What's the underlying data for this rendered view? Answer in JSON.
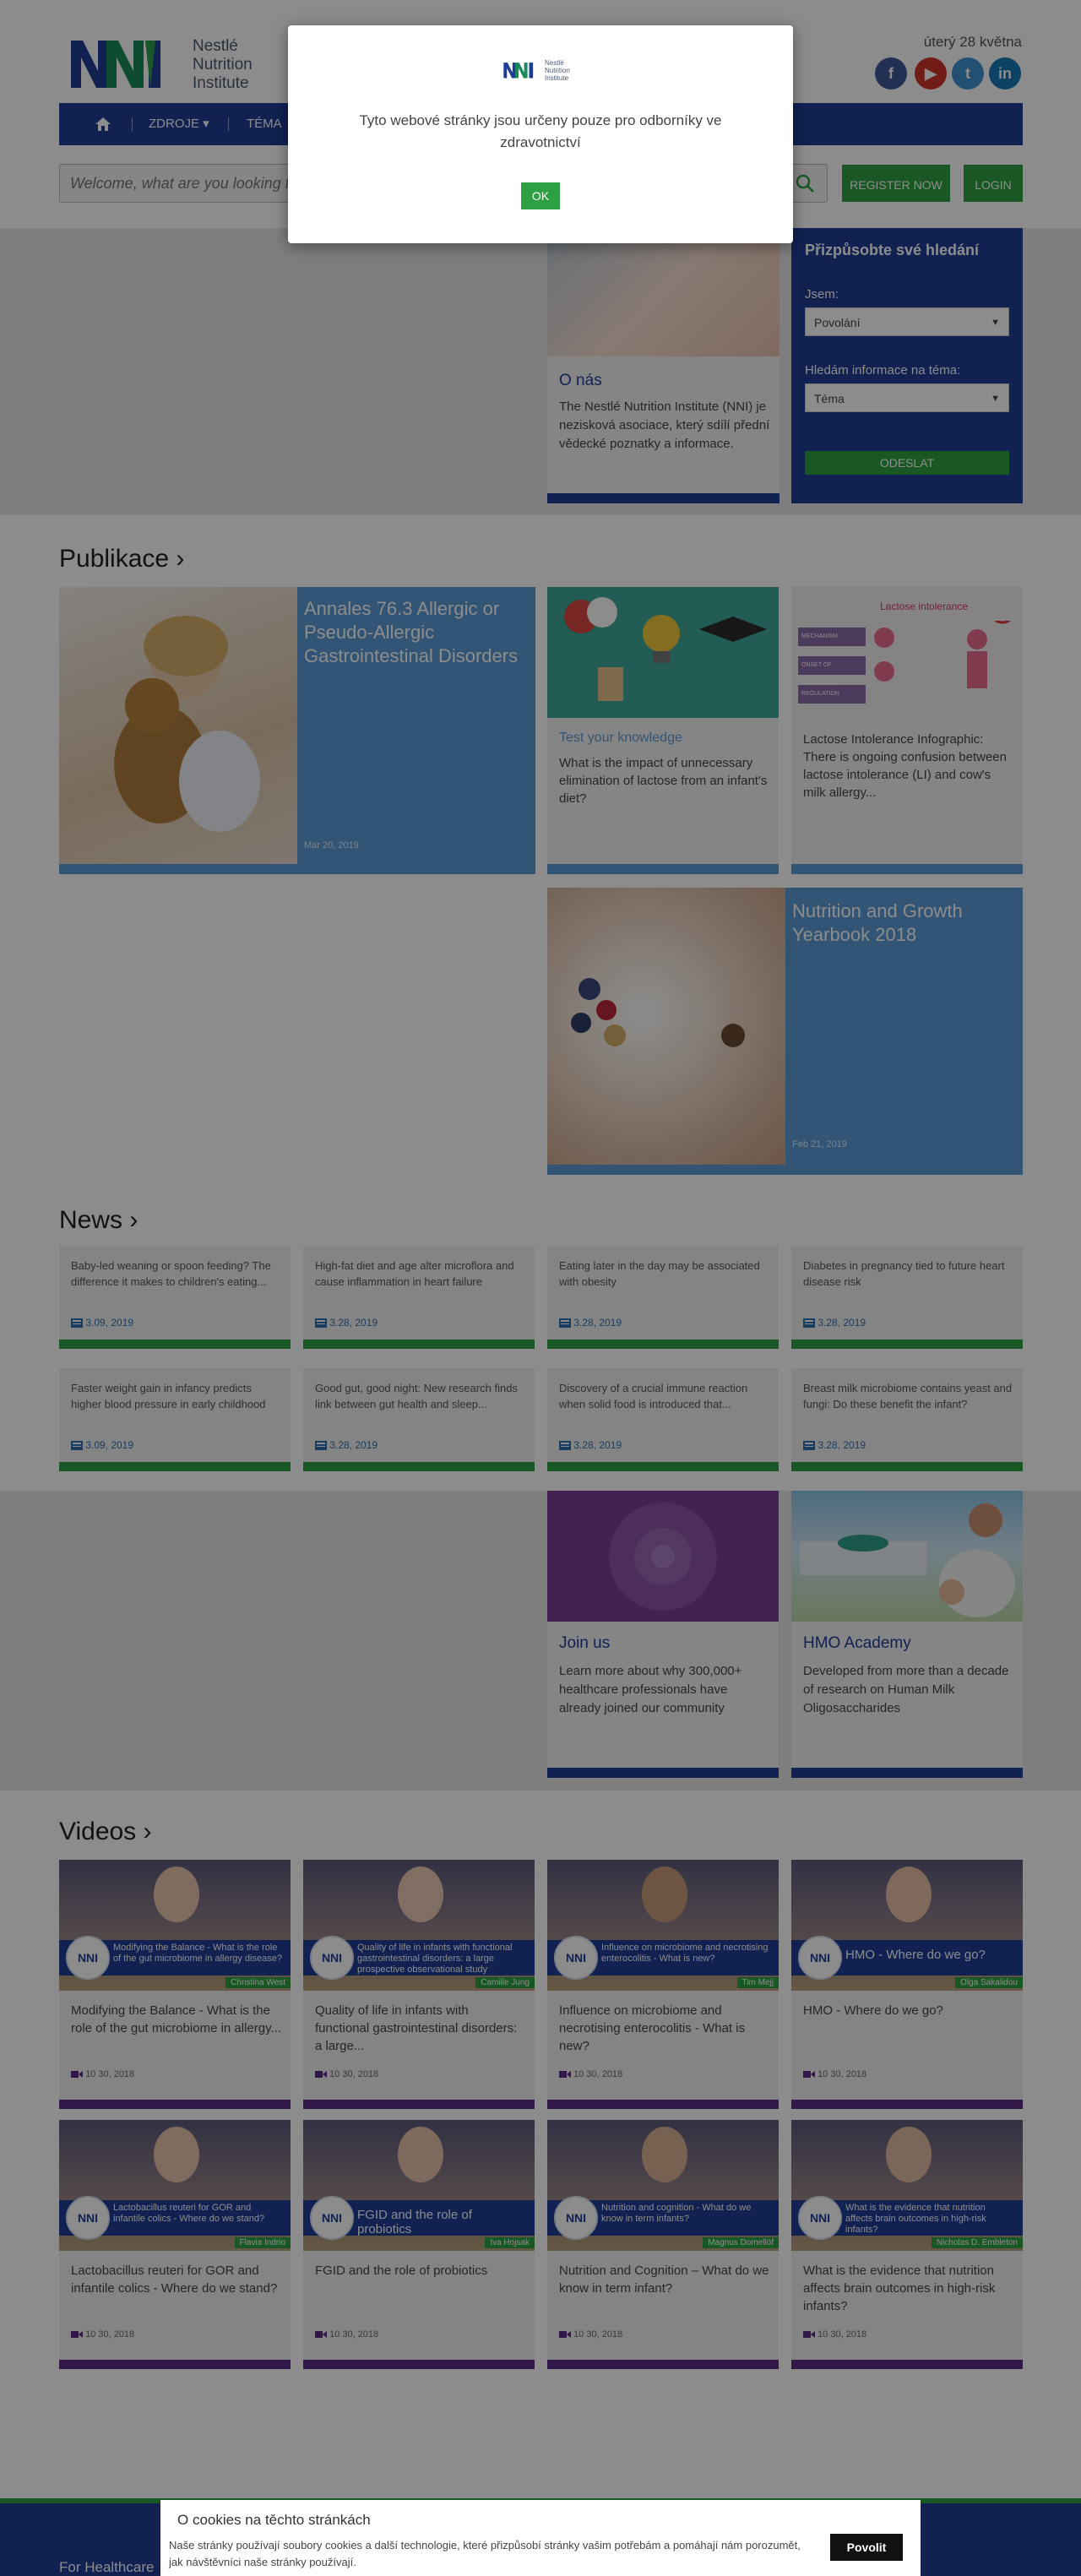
{
  "header": {
    "logo_text": [
      "Nestlé",
      "Nutrition",
      "Institute"
    ],
    "date": "úterý 28 května",
    "social": [
      {
        "name": "facebook",
        "glyph": "f",
        "color": "#3b5998"
      },
      {
        "name": "youtube",
        "glyph": "▶",
        "color": "#d0332c"
      },
      {
        "name": "twitter",
        "glyph": "t",
        "color": "#3f92d2"
      },
      {
        "name": "linkedin",
        "glyph": "in",
        "color": "#1678b5"
      }
    ],
    "nav": {
      "home_icon": "home-icon",
      "items": [
        "ZDROJE ▾",
        "TÉMA"
      ]
    },
    "search_placeholder": "Welcome, what are you looking for?",
    "register": "REGISTER NOW",
    "login": "LOGIN"
  },
  "about": {
    "title": "O nás",
    "text": "The Nestlé Nutrition Institute (NNI) je nezisková asociace, který sdílí přední vědecké poznatky a informace."
  },
  "filter": {
    "title": "Přizpůsobte své hledání",
    "label_iam": "Jsem:",
    "select_iam": "Povolání",
    "label_topic": "Hledám informace na téma:",
    "select_topic": "Téma",
    "submit": "ODESLAT"
  },
  "publications": {
    "title": "Publikace ›",
    "featured": {
      "title": "Annales 76.3 Allergic or Pseudo-Allergic Gastrointestinal Disorders",
      "date": "Mar 20, 2019"
    },
    "quiz": {
      "tag": "Test your knowledge",
      "text": "What is the impact of unnecessary elimination of lactose from an infant's diet?"
    },
    "infographic": {
      "text": "Lactose Intolerance Infographic: There is ongoing confusion between lactose intolerance (LI) and cow's milk allergy...",
      "img_title": "Lactose intolerance",
      "img_rows": [
        "MECHANISM",
        "ONSET OF SYMPTOMS",
        "REGULATION"
      ]
    },
    "featured2": {
      "title": "Nutrition and Growth Yearbook 2018",
      "date": "Feb 21, 2019"
    }
  },
  "news": {
    "title": "News ›",
    "items": [
      {
        "text": "Baby-led weaning or spoon feeding? The difference it makes to children's eating...",
        "date": "3.09, 2019"
      },
      {
        "text": "High-fat diet and age alter microflora and cause inflammation in heart failure",
        "date": "3.28, 2019"
      },
      {
        "text": "Eating later in the day may be associated with obesity",
        "date": "3.28, 2019"
      },
      {
        "text": "Diabetes in pregnancy tied to future heart disease risk",
        "date": "3.28, 2019"
      },
      {
        "text": "Faster weight gain in infancy predicts higher blood pressure in early childhood",
        "date": "3.09, 2019"
      },
      {
        "text": "Good gut, good night: New research finds link between gut health and sleep...",
        "date": "3.28, 2019"
      },
      {
        "text": "Discovery of a crucial immune reaction when solid food is introduced that...",
        "date": "3.28, 2019"
      },
      {
        "text": "Breast milk microbiome contains yeast and fungi: Do these benefit the infant?",
        "date": "3.28, 2019"
      }
    ]
  },
  "join": {
    "title": "Join us",
    "text": "Learn more about why 300,000+ healthcare professionals have already joined our community"
  },
  "hmo": {
    "title": "HMO Academy",
    "text": "Developed from more than a decade of research on Human Milk Oligosaccharides"
  },
  "videos": {
    "title": "Videos ›",
    "items": [
      {
        "thumb_title": "Modifying the Balance - What is the role of the gut microbiome in allergy disease?",
        "speaker": "Christina West",
        "title": "Modifying the Balance - What is the role of the gut microbiome in allergy...",
        "date": "10 30, 2018",
        "big": false
      },
      {
        "thumb_title": "Quality of life in infants with functional gastrointestinal disorders: a large prospective observational study",
        "speaker": "Camille Jung",
        "title": "Quality of life in infants with functional gastrointestinal disorders: a large...",
        "date": "10 30, 2018",
        "big": false
      },
      {
        "thumb_title": "Influence on microbiome and necrotising enterocolitis - What is new?",
        "speaker": "Tim Mejj",
        "title": "Influence on microbiome and necrotising enterocolitis - What is new?",
        "date": "10 30, 2018",
        "big": false
      },
      {
        "thumb_title": "HMO - Where do we go?",
        "speaker": "Olga Sakalidou",
        "title": "HMO - Where do we go?",
        "date": "10 30, 2018",
        "big": true
      },
      {
        "thumb_title": "Lactobacillus reuteri for GOR and infantile colics - Where do we stand?",
        "speaker": "Flavia Indrio",
        "title": "Lactobacillus reuteri for GOR and infantile colics - Where do we stand?",
        "date": "10 30, 2018",
        "big": false
      },
      {
        "thumb_title": "FGID and the role of probiotics",
        "speaker": "Iva Hojsak",
        "title": "FGID and the role of probiotics",
        "date": "10 30, 2018",
        "big": true
      },
      {
        "thumb_title": "Nutrition and cognition - What do we know in term infants?",
        "speaker": "Magnus Domellöf",
        "title": "Nutrition and Cognition – What do we know in term infant?",
        "date": "10 30, 2018",
        "big": false
      },
      {
        "thumb_title": "What is the evidence that nutrition affects brain outcomes in high-risk infants?",
        "speaker": "Nicholas D. Embleton",
        "title": "What is the evidence that nutrition affects brain outcomes in high-risk infants?",
        "date": "10 30, 2018",
        "big": false
      }
    ]
  },
  "footer": {
    "text": "For Healthcare"
  },
  "modal": {
    "logo_text": [
      "Nestlé",
      "Nutrition",
      "Institute"
    ],
    "message": "Tyto webové stránky jsou určeny pouze pro odborníky ve zdravotnictví",
    "ok": "OK"
  },
  "cookie": {
    "title": "O cookies na těchto stránkách",
    "text": "Naše stránky používají soubory cookies a další technologie, které přizpůsobí stránky vašim potřebám a pomáhají nám porozumět, jak návštěvníci naše stránky používají.",
    "allow": "Povolit"
  },
  "colors": {
    "brand_blue": "#1e3d96",
    "accent_green": "#2ea043",
    "pub_blue": "#5b9bd5",
    "video_purple": "#5b2c83"
  }
}
